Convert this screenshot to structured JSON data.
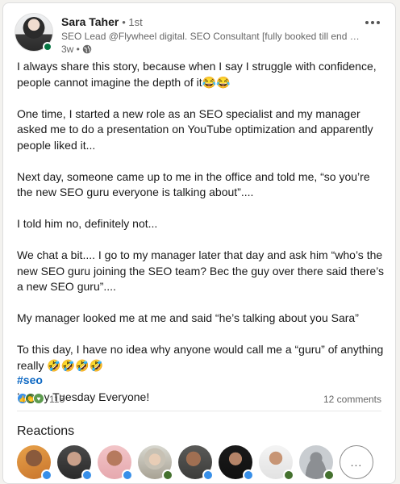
{
  "author": {
    "name": "Sara Taher",
    "degree": "• 1st",
    "headline": "SEO Lead @Flywheel digital. SEO Consultant [fully booked till end of ye...",
    "time": "3w •",
    "visibility_icon": "globe-icon"
  },
  "post": {
    "paragraphs": [
      "I always share this story, because when I say I struggle with confidence, people cannot imagine the depth of it😂😂",
      "One time, I started a new role as an SEO specialist and my manager asked me to do a presentation on YouTube optimization and apparently people liked it...",
      "Next day, someone came up to me in the office and told me, “so you’re the new SEO guru everyone is talking about”....",
      "I told him no, definitely not...",
      "We chat a bit.... I go to my manager later that day and ask him “who’s the new SEO guru joining the SEO team? Bec the guy over there said there’s a new SEO guru”....",
      "My manager looked me at me and said “he’s talking about you Sara”",
      "To this day, I have no idea why anyone would call me a “guru” of anything really 🤣🤣🤣🤣",
      "Happy Tuesday Everyone!"
    ],
    "hashtag": "#seo"
  },
  "social": {
    "reaction_count": "113",
    "comments": "12 comments",
    "reaction_icons": [
      "like-icon",
      "celebrate-icon",
      "support-icon"
    ]
  },
  "reactions_section": {
    "title": "Reactions",
    "more_label": "..."
  },
  "colors": {
    "link": "#0a66c2",
    "like": "#378fe9",
    "celebrate": "#44712e"
  }
}
